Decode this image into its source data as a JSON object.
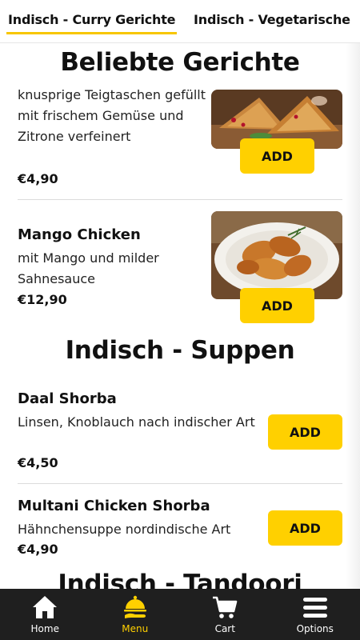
{
  "tabs": [
    {
      "label": "Indisch - Curry Gerichte",
      "active": true
    },
    {
      "label": "Indisch - Vegetarische",
      "active": false
    }
  ],
  "sections": {
    "popular": {
      "title": "Beliebte Gerichte",
      "items": [
        {
          "name": "",
          "description": "knusprige Teigtaschen gefüllt mit frischem Gemüse und Zitrone verfeinert",
          "price": "€4,90",
          "add_label": "ADD"
        },
        {
          "name": "Mango Chicken",
          "description": "mit Mango und milder Sahnesauce",
          "price": "€12,90",
          "add_label": "ADD"
        }
      ]
    },
    "soups": {
      "title": "Indisch - Suppen",
      "items": [
        {
          "name": "Daal Shorba",
          "description": "Linsen, Knoblauch nach indischer Art",
          "price": "€4,50",
          "add_label": "ADD"
        },
        {
          "name": "Multani Chicken Shorba",
          "description": "Hähnchensuppe nordindische Art",
          "price": "€4,90",
          "add_label": "ADD"
        }
      ]
    },
    "tandoori": {
      "title": "Indisch - Tandoori"
    }
  },
  "bottom_nav": [
    {
      "label": "Home",
      "icon": "home-icon",
      "active": false
    },
    {
      "label": "Menu",
      "icon": "serving-cloche-icon",
      "active": true
    },
    {
      "label": "Cart",
      "icon": "cart-icon",
      "active": false
    },
    {
      "label": "Options",
      "icon": "hamburger-menu-icon",
      "active": false
    }
  ],
  "colors": {
    "accent": "#ffd000",
    "nav_bg": "#1f1f1f"
  }
}
